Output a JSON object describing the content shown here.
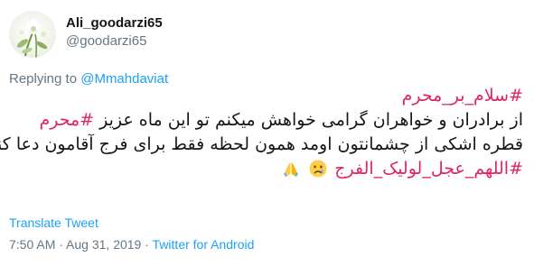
{
  "author": {
    "display_name": "Ali_goodarzi65",
    "handle": "@goodarzi65",
    "avatar_icon": "flower-photo-icon"
  },
  "reply": {
    "prefix": "Replying to",
    "target": "@Mmahdaviat"
  },
  "body": {
    "line1_hashtag": "#سلام_بر_محرم",
    "line2_text": "از برادران و خواهران گرامی خواهش میکنم تو این ماه عزیز",
    "line2_hashtag": "#محرم",
    "line3_text": "قطره اشکی از چشمانتون اومد همون لحظه فقط برای فرج آقامون دعا کنید",
    "line4_hashtag": "#اللهم_عجل_لولیک_الفرج",
    "emoji_1": "crying-face-emoji",
    "emoji_2": "folded-hands-emoji"
  },
  "translate_label": "Translate Tweet",
  "meta": {
    "time": "7:50 AM",
    "separator1": " · ",
    "date": "Aug 31, 2019",
    "separator2": " · ",
    "source": "Twitter for Android"
  },
  "colors": {
    "hashtag": "#e0245e",
    "link": "#1da1f2",
    "secondary_text": "#657786",
    "primary_text": "#14171a"
  }
}
